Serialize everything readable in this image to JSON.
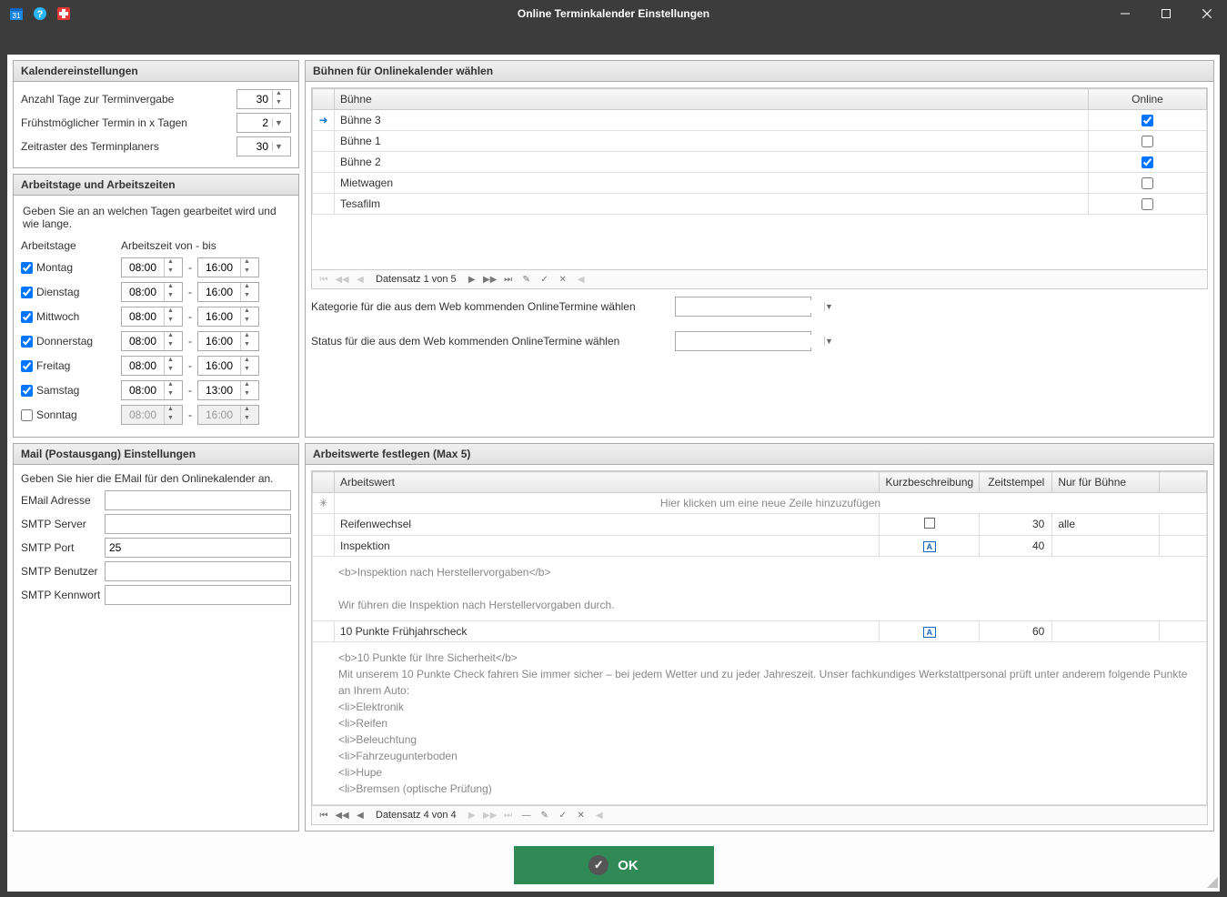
{
  "window": {
    "title": "Online Terminkalender Einstellungen"
  },
  "calendar": {
    "header": "Kalendereinstellungen",
    "days_label": "Anzahl Tage zur Terminvergabe",
    "days_value": "30",
    "earliest_label": "Frühstmöglicher Termin in x Tagen",
    "earliest_value": "2",
    "raster_label": "Zeitraster des Terminplaners",
    "raster_value": "30"
  },
  "workdays": {
    "header": "Arbeitstage und Arbeitszeiten",
    "desc": "Geben Sie an an welchen Tagen gearbeitet wird und wie lange.",
    "col_day": "Arbeitstage",
    "col_time": "Arbeitszeit von - bis",
    "rows": [
      {
        "day": "Montag",
        "checked": true,
        "from": "08:00",
        "to": "16:00"
      },
      {
        "day": "Dienstag",
        "checked": true,
        "from": "08:00",
        "to": "16:00"
      },
      {
        "day": "Mittwoch",
        "checked": true,
        "from": "08:00",
        "to": "16:00"
      },
      {
        "day": "Donnerstag",
        "checked": true,
        "from": "08:00",
        "to": "16:00"
      },
      {
        "day": "Freitag",
        "checked": true,
        "from": "08:00",
        "to": "16:00"
      },
      {
        "day": "Samstag",
        "checked": true,
        "from": "08:00",
        "to": "13:00"
      },
      {
        "day": "Sonntag",
        "checked": false,
        "from": "08:00",
        "to": "16:00"
      }
    ]
  },
  "stages": {
    "header": "Bühnen für Onlinekalender wählen",
    "col_name": "Bühne",
    "col_online": "Online",
    "rows": [
      {
        "name": "Bühne 3",
        "online": true,
        "current": true
      },
      {
        "name": "Bühne 1",
        "online": false
      },
      {
        "name": "Bühne 2",
        "online": true
      },
      {
        "name": "Mietwagen",
        "online": false
      },
      {
        "name": "Tesafilm",
        "online": false
      }
    ],
    "nav_text": "Datensatz 1 von 5",
    "category_label": "Kategorie für die aus dem Web kommenden OnlineTermine wählen",
    "status_label": "Status für die aus dem Web kommenden OnlineTermine wählen"
  },
  "mail": {
    "header": "Mail (Postausgang) Einstellungen",
    "desc": "Geben Sie hier die EMail für den Onlinekalender an.",
    "email_label": "EMail Adresse",
    "server_label": "SMTP Server",
    "port_label": "SMTP Port",
    "port_value": "25",
    "user_label": "SMTP Benutzer",
    "pass_label": "SMTP Kennwort"
  },
  "arbeitswerte": {
    "header": "Arbeitswerte festlegen (Max 5)",
    "col_name": "Arbeitswert",
    "col_kurz": "Kurzbeschreibung",
    "col_zeit": "Zeitstempel",
    "col_buehne": "Nur für Bühne",
    "new_row_hint": "Hier klicken um eine neue Zeile hinzuzufügen",
    "rows": [
      {
        "name": "Reifenwechsel",
        "zeit": "30",
        "buehne": "alle",
        "icon": "doc"
      },
      {
        "name": "Inspektion",
        "zeit": "40",
        "buehne": "",
        "icon": "a",
        "desc": "<b>Inspektion nach Herstellervorgaben</b>\n\nWir führen die Inspektion nach Herstellervorgaben durch."
      },
      {
        "name": "10 Punkte Frühjahrscheck",
        "zeit": "60",
        "buehne": "",
        "icon": "a",
        "desc": "<b>10 Punkte für Ihre Sicherheit</b>\nMit unserem 10 Punkte Check fahren Sie immer sicher – bei jedem Wetter und zu jeder Jahreszeit. Unser fachkundiges Werkstattpersonal prüft unter anderem folgende Punkte an Ihrem Auto:\n<li>Elektronik\n<li>Reifen\n<li>Beleuchtung\n<li>Fahrzeugunterboden\n<li>Hupe\n<li>Bremsen (optische Prüfung)"
      }
    ],
    "nav_text": "Datensatz 4 von 4"
  },
  "footer": {
    "ok": "OK"
  }
}
